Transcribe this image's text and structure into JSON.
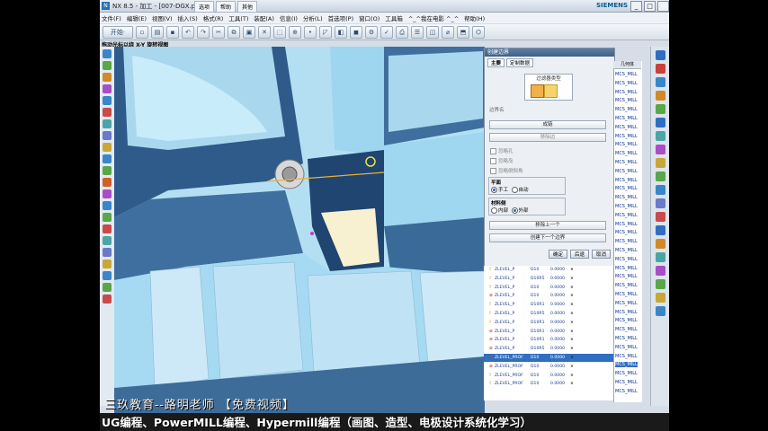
{
  "window": {
    "title": "NX 8.5 - 加工 - [007-DGX.prt]",
    "tabs": [
      "选项",
      "帮助",
      "其他"
    ],
    "brand": "SIEMENS",
    "min": "_",
    "max": "□",
    "close": "×"
  },
  "menu": [
    "文件(F)",
    "编辑(E)",
    "视图(V)",
    "插入(S)",
    "格式(R)",
    "工具(T)",
    "装配(A)",
    "信息(I)",
    "分析(L)",
    "首选项(P)",
    "窗口(O)",
    "工具箱",
    "^_^我在电影 ^_^",
    "帮助(H)"
  ],
  "toolbar": {
    "start": "开始·",
    "view_label": "拖动光标以绕 X-Y 旋转视图"
  },
  "dialog": {
    "title": "创建边界",
    "tab_main": "主要",
    "tab_custom": "定制数据",
    "filter_type": "过滤器类型",
    "name_label": "边界名",
    "btn_create": "成链",
    "btn_remove": "移除边",
    "chk_ignore_holes": "忽略孔",
    "chk_ignore_islands": "忽略岛",
    "chk_ignore_chamfers": "忽略倒斜角",
    "plane_header": "平面",
    "plane_manual": "手工",
    "plane_auto": "自动",
    "material_header": "材料侧",
    "material_inside": "内部",
    "material_outside": "外部",
    "btn_remove_last": "移除上一个",
    "btn_create_next": "创建下一个边界",
    "ok": "确定",
    "back": "后退",
    "cancel": "取消"
  },
  "nav": {
    "header": "几何体",
    "rows": [
      "MCS_MILL",
      "MCS_MILL",
      "MCS_MILL",
      "MCS_MILL",
      "MCS_MILL",
      "MCS_MILL",
      "MCS_MILL",
      "MCS_MILL",
      "MCS_MILL",
      "MCS_MILL",
      "MCS_MILL",
      "MCS_MILL",
      "MCS_MILL",
      "MCS_MILL",
      "MCS_MILL",
      "MCS_MILL",
      "MCS_MILL",
      "MCS_MILL",
      "MCS_MILL",
      "MCS_MILL",
      "MCS_MILL",
      "MCS_MILL",
      "MCS_MILL",
      "MCS_MILL",
      "MCS_MILL",
      "MCS_MILL",
      "MCS_MILL",
      "MCS_MILL",
      "MCS_MILL",
      "MCS_MILL",
      "MCS_MILL",
      "MCS_MILL",
      "MCS_MILL",
      "MCS_MILL",
      "MCS_MILL",
      "MCS_MILL",
      "MCS_MILL"
    ]
  },
  "operations": [
    {
      "status": "!",
      "name": "ZLEVEL_P",
      "tool": "D10",
      "time": "0.0000",
      "flag": "×",
      "geom": "MCS_MILL"
    },
    {
      "status": "!",
      "name": "ZLEVEL_P",
      "tool": "D10R5",
      "time": "0.0000",
      "flag": "×",
      "geom": "MCS_MILL"
    },
    {
      "status": "!",
      "name": "ZLEVEL_P",
      "tool": "D10",
      "time": "0.0000",
      "flag": "×",
      "geom": "MCS_MILL"
    },
    {
      "status": "⊘",
      "name": "ZLEVEL_P",
      "tool": "D10",
      "time": "0.0000",
      "flag": "×",
      "geom": "MCS_MILL"
    },
    {
      "status": "!",
      "name": "ZLEVEL_P",
      "tool": "D10R1",
      "time": "0.0000",
      "flag": "×",
      "geom": "MCS_MILL"
    },
    {
      "status": "!",
      "name": "ZLEVEL_P",
      "tool": "D10R5",
      "time": "0.0000",
      "flag": "×",
      "geom": "MCS_MILL"
    },
    {
      "status": "!",
      "name": "ZLEVEL_P",
      "tool": "D10R1",
      "time": "0.0000",
      "flag": "×",
      "geom": "MCS_MILL"
    },
    {
      "status": "⊘",
      "name": "ZLEVEL_P",
      "tool": "D10R1",
      "time": "0.0000",
      "flag": "×",
      "geom": "MCS_MILL"
    },
    {
      "status": "⊘",
      "name": "ZLEVEL_P",
      "tool": "D10R1",
      "time": "0.0000",
      "flag": "×",
      "geom": "MCS_MILL"
    },
    {
      "status": "⊘",
      "name": "ZLEVEL_P",
      "tool": "D10R5",
      "time": "0.0000",
      "flag": "×",
      "geom": "MCS_MILL"
    },
    {
      "status": "⊘",
      "name": "ZLEVEL_PROF",
      "tool": "D10",
      "time": "0.0000",
      "flag": "×",
      "geom": "MCS_MILL"
    },
    {
      "status": "⊘",
      "name": "ZLEVEL_PROF",
      "tool": "D10",
      "time": "0.0000",
      "flag": "×",
      "geom": "MCS_MILL"
    },
    {
      "status": "!",
      "name": "ZLEVEL_PROF",
      "tool": "D10",
      "time": "0.0000",
      "flag": "×",
      "geom": "MCS_MILL"
    },
    {
      "status": "!",
      "name": "ZLEVEL_PROF",
      "tool": "D10",
      "time": "0.0000",
      "flag": "×",
      "geom": "MCS_MILL"
    }
  ],
  "banner": {
    "line1": "三玖教育--路明老师  【免费视频】",
    "line2": "UG编程、PowerMILL编程、Hypermill编程（画图、造型、电极设计系统化学习）"
  }
}
